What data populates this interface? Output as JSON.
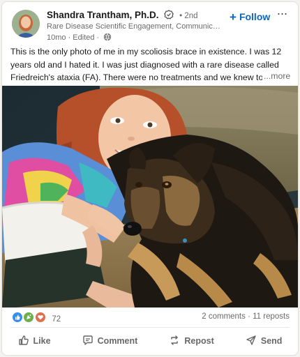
{
  "author": {
    "name": "Shandra Trantham, Ph.D.",
    "degree": "2nd",
    "headline": "Rare Disease Scientific Engagement, Communication, a...",
    "meta": "10mo · Edited ·"
  },
  "header": {
    "follow_label": "Follow",
    "more_icon": "···"
  },
  "post": {
    "text": "This is the only photo of me in my scoliosis brace in existence. I was 12 years old and I hated it. I was just diagnosed with a rare disease called Friedreich's ataxia (FA). There were no treatments and we knew to expect a short",
    "see_more": "...more"
  },
  "social": {
    "reaction_count": "72",
    "comments": "2 comments",
    "separator": "·",
    "reposts": "11 reposts"
  },
  "actions": [
    {
      "label": "Like",
      "icon": "thumbs-up-icon"
    },
    {
      "label": "Comment",
      "icon": "comment-icon"
    },
    {
      "label": "Repost",
      "icon": "repost-icon"
    },
    {
      "label": "Send",
      "icon": "send-icon"
    }
  ],
  "colors": {
    "accent": "#0a66c2",
    "like": "#378fe9",
    "celebrate": "#6dae4f",
    "love": "#df704d"
  }
}
